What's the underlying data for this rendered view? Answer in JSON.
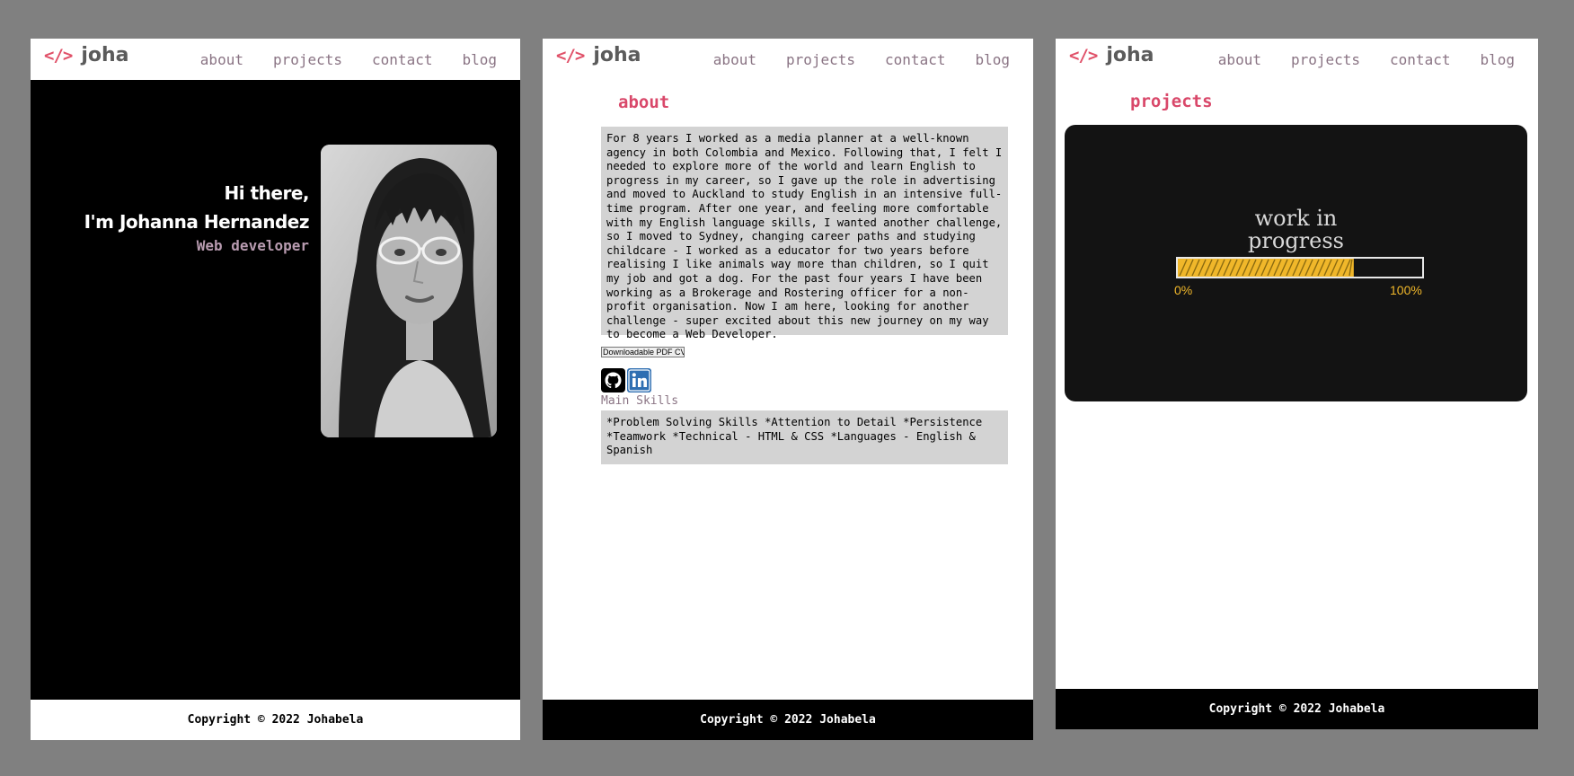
{
  "brand": {
    "mark": "</>",
    "name": "joha",
    "accent": "#e05068"
  },
  "nav": [
    "about",
    "projects",
    "contact",
    "blog"
  ],
  "hero": {
    "greeting": "Hi there,",
    "name": "I'm Johanna Hernandez",
    "role": "Web developer"
  },
  "about": {
    "title": "about",
    "text": "For 8 years I worked as a media planner at a well-known agency in both Colombia and Mexico. Following that, I felt I needed to explore more of the world and learn English to progress in my career, so I gave up the role in advertising and moved to Auckland to study English in an intensive full-time program. After one year, and feeling more comfortable with my English language skills, I wanted another challenge, so I moved to Sydney, changing career paths and studying childcare - I worked as a educator for two years before realising I like animals way more than children, so I quit my job and got a dog. For the past four years I have been working as a Brokerage and Rostering officer for a non-profit organisation. Now I am here, looking for another challenge - super excited about this new journey on my way to become a Web Developer.",
    "cv_button": "Downloadable PDF CV",
    "social_icons": [
      "github-icon",
      "linkedin-icon"
    ],
    "skills_label": "Main Skills",
    "skills": "*Problem Solving Skills *Attention to Detail *Persistence *Teamwork *Technical - HTML & CSS *Languages - English & Spanish"
  },
  "projects": {
    "title": "projects",
    "wip_title_line1": "work in",
    "wip_title_line2": "progress",
    "wip_start_label": "0%",
    "wip_end_label": "100%",
    "wip_progress": 0.72
  },
  "footer": {
    "text": "Copyright © 2022 Johabela"
  },
  "colors": {
    "background": "#808080",
    "accent": "#e05068",
    "nav": "#8a7484",
    "hero_bg": "#000000",
    "panel_bg": "#ffffff",
    "box_bg": "#d3d3d3",
    "wip_yellow": "#f0b72a"
  }
}
